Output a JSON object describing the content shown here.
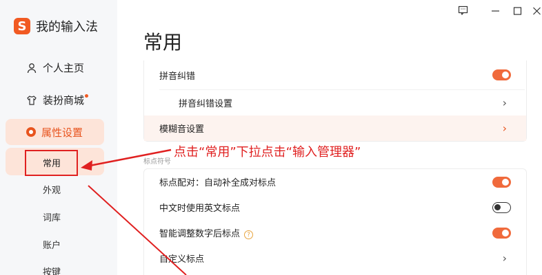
{
  "brand": {
    "logo": "S",
    "name": "我的输入法"
  },
  "window_controls": [
    "feedback-icon",
    "minimize-icon",
    "maximize-icon",
    "close-icon"
  ],
  "sidebar": {
    "items": [
      {
        "label": "个人主页",
        "icon": "user-icon"
      },
      {
        "label": "装扮商城",
        "icon": "shirt-icon",
        "badge": true
      },
      {
        "label": "属性设置",
        "icon": "settings-ring-icon",
        "active": true
      }
    ],
    "subitems": [
      {
        "label": "常用",
        "active": true
      },
      {
        "label": "外观"
      },
      {
        "label": "词库"
      },
      {
        "label": "账户"
      },
      {
        "label": "按键"
      }
    ]
  },
  "main": {
    "title": "常用",
    "group1": [
      {
        "label": "拼音纠错",
        "control": "toggle",
        "on": true
      },
      {
        "label": "拼音纠错设置",
        "control": "chevron"
      },
      {
        "label": "模糊音设置",
        "control": "chevron",
        "highlight": true
      }
    ],
    "section_label": "标点符号",
    "group2": [
      {
        "label": "标点配对：自动补全成对标点",
        "control": "toggle",
        "on": true
      },
      {
        "label": "中文时使用英文标点",
        "control": "toggle",
        "on": false
      },
      {
        "label": "智能调整数字后标点",
        "control": "toggle",
        "on": true,
        "help": "?"
      },
      {
        "label": "自定义标点",
        "control": "chevron"
      }
    ]
  },
  "annotation": "点击“常用”下拉点击“输入管理器”",
  "colors": {
    "accent": "#f15a22",
    "annotation": "#e02020",
    "active_bg": "#fde4d9"
  }
}
